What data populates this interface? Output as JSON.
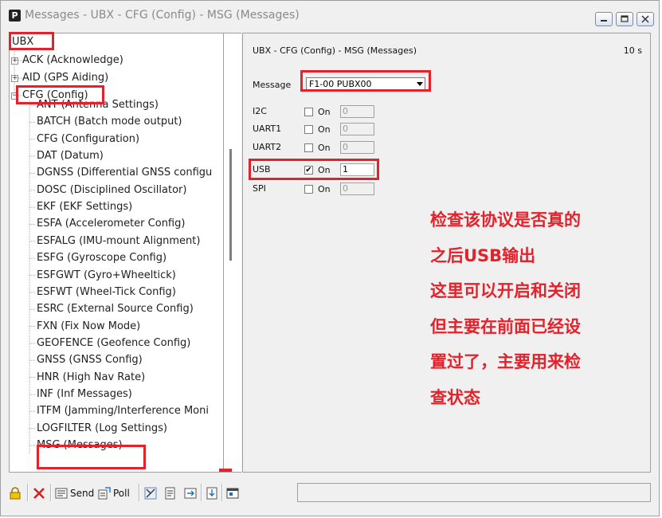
{
  "window": {
    "title": "Messages - UBX - CFG (Config) - MSG (Messages)",
    "app_icon_letter": "P"
  },
  "tree": {
    "root": "UBX",
    "groups": [
      {
        "label": "ACK (Acknowledge)",
        "expander": "+"
      },
      {
        "label": "AID (GPS Aiding)",
        "expander": "+"
      },
      {
        "label": "CFG (Config)",
        "expander": "−"
      }
    ],
    "cfg_children": [
      "ANT (Antenna Settings)",
      "BATCH (Batch mode output)",
      "CFG (Configuration)",
      "DAT (Datum)",
      "DGNSS (Differential GNSS configu",
      "DOSC (Disciplined Oscillator)",
      "EKF (EKF Settings)",
      "ESFA (Accelerometer Config)",
      "ESFALG (IMU-mount Alignment)",
      "ESFG (Gyroscope Config)",
      "ESFGWT (Gyro+Wheeltick)",
      "ESFWT (Wheel-Tick Config)",
      "ESRC (External Source Config)",
      "FXN (Fix Now Mode)",
      "GEOFENCE (Geofence Config)",
      "GNSS (GNSS Config)",
      "HNR (High Nav Rate)",
      "INF (Inf Messages)",
      "ITFM (Jamming/Interference Moni",
      "LOGFILTER (Log Settings)",
      "MSG (Messages)"
    ]
  },
  "panel": {
    "title": "UBX - CFG (Config) - MSG (Messages)",
    "rate": "10 s",
    "message_label": "Message",
    "message_value": "F1-00 PUBX00",
    "on_label": "On",
    "ports": [
      {
        "name": "I2C",
        "checked": false,
        "value": "0"
      },
      {
        "name": "UART1",
        "checked": false,
        "value": "0"
      },
      {
        "name": "UART2",
        "checked": false,
        "value": "0"
      },
      {
        "name": "USB",
        "checked": true,
        "value": "1"
      },
      {
        "name": "SPI",
        "checked": false,
        "value": "0"
      }
    ],
    "check_mark": "✔"
  },
  "annotation": {
    "lines": [
      "检查该协议是否真的",
      "之后USB输出",
      "这里可以开启和关闭",
      "但主要在前面已经设",
      "置过了，主要用来检",
      "查状态"
    ],
    "color": "#e3222b"
  },
  "toolbar": {
    "send_label": "Send",
    "poll_label": "Poll"
  }
}
